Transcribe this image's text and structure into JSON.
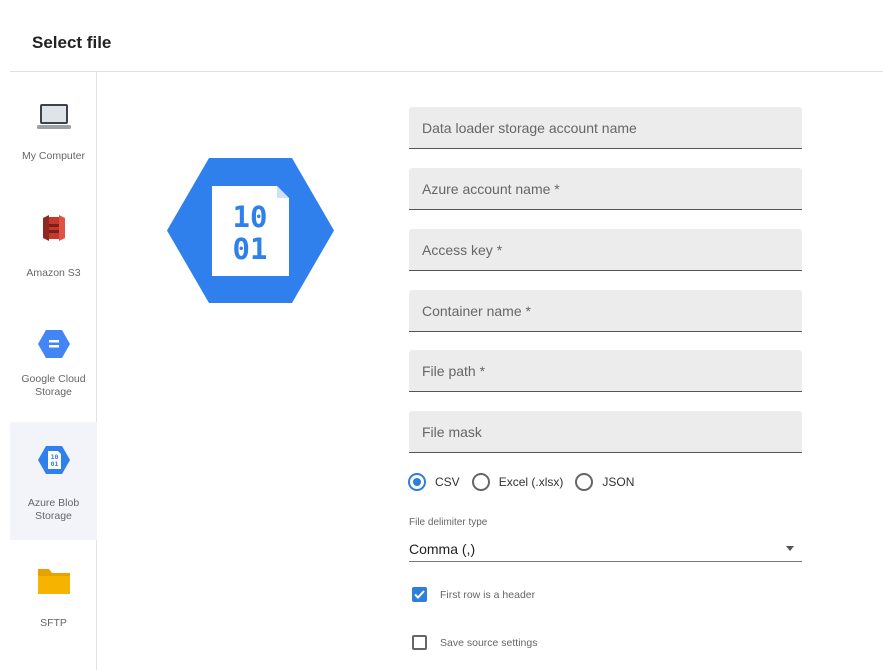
{
  "header": {
    "title": "Select file"
  },
  "sidebar": {
    "items": [
      {
        "label": "My Computer",
        "icon": "laptop-icon"
      },
      {
        "label": "Amazon S3",
        "icon": "amazon-s3-icon"
      },
      {
        "label": "Google Cloud Storage",
        "icon": "google-cloud-storage-icon"
      },
      {
        "label": "Azure Blob Storage",
        "icon": "azure-blob-storage-icon",
        "active": true
      },
      {
        "label": "SFTP",
        "icon": "folder-icon"
      }
    ]
  },
  "logo": {
    "line1": "10",
    "line2": "01",
    "icon": "azure-blob-storage-icon"
  },
  "form": {
    "fields": [
      {
        "placeholder": "Data loader storage account name",
        "value": ""
      },
      {
        "placeholder": "Azure account name *",
        "value": ""
      },
      {
        "placeholder": "Access key *",
        "value": ""
      },
      {
        "placeholder": "Container name *",
        "value": ""
      },
      {
        "placeholder": "File path *",
        "value": ""
      },
      {
        "placeholder": "File mask",
        "value": ""
      }
    ],
    "formats": [
      {
        "label": "CSV",
        "checked": true
      },
      {
        "label": "Excel (.xlsx)",
        "checked": false
      },
      {
        "label": "JSON",
        "checked": false
      }
    ],
    "delimiter": {
      "label": "File delimiter type",
      "value": "Comma (,)"
    },
    "first_row_header": {
      "label": "First row is a header",
      "checked": true
    },
    "save_settings": {
      "label": "Save source settings",
      "checked": false
    }
  },
  "colors": {
    "azure_blue": "#2f80ed",
    "accent": "#2e7fd9",
    "amazon_red": "#c7382c",
    "folder_yellow": "#f6b400"
  }
}
